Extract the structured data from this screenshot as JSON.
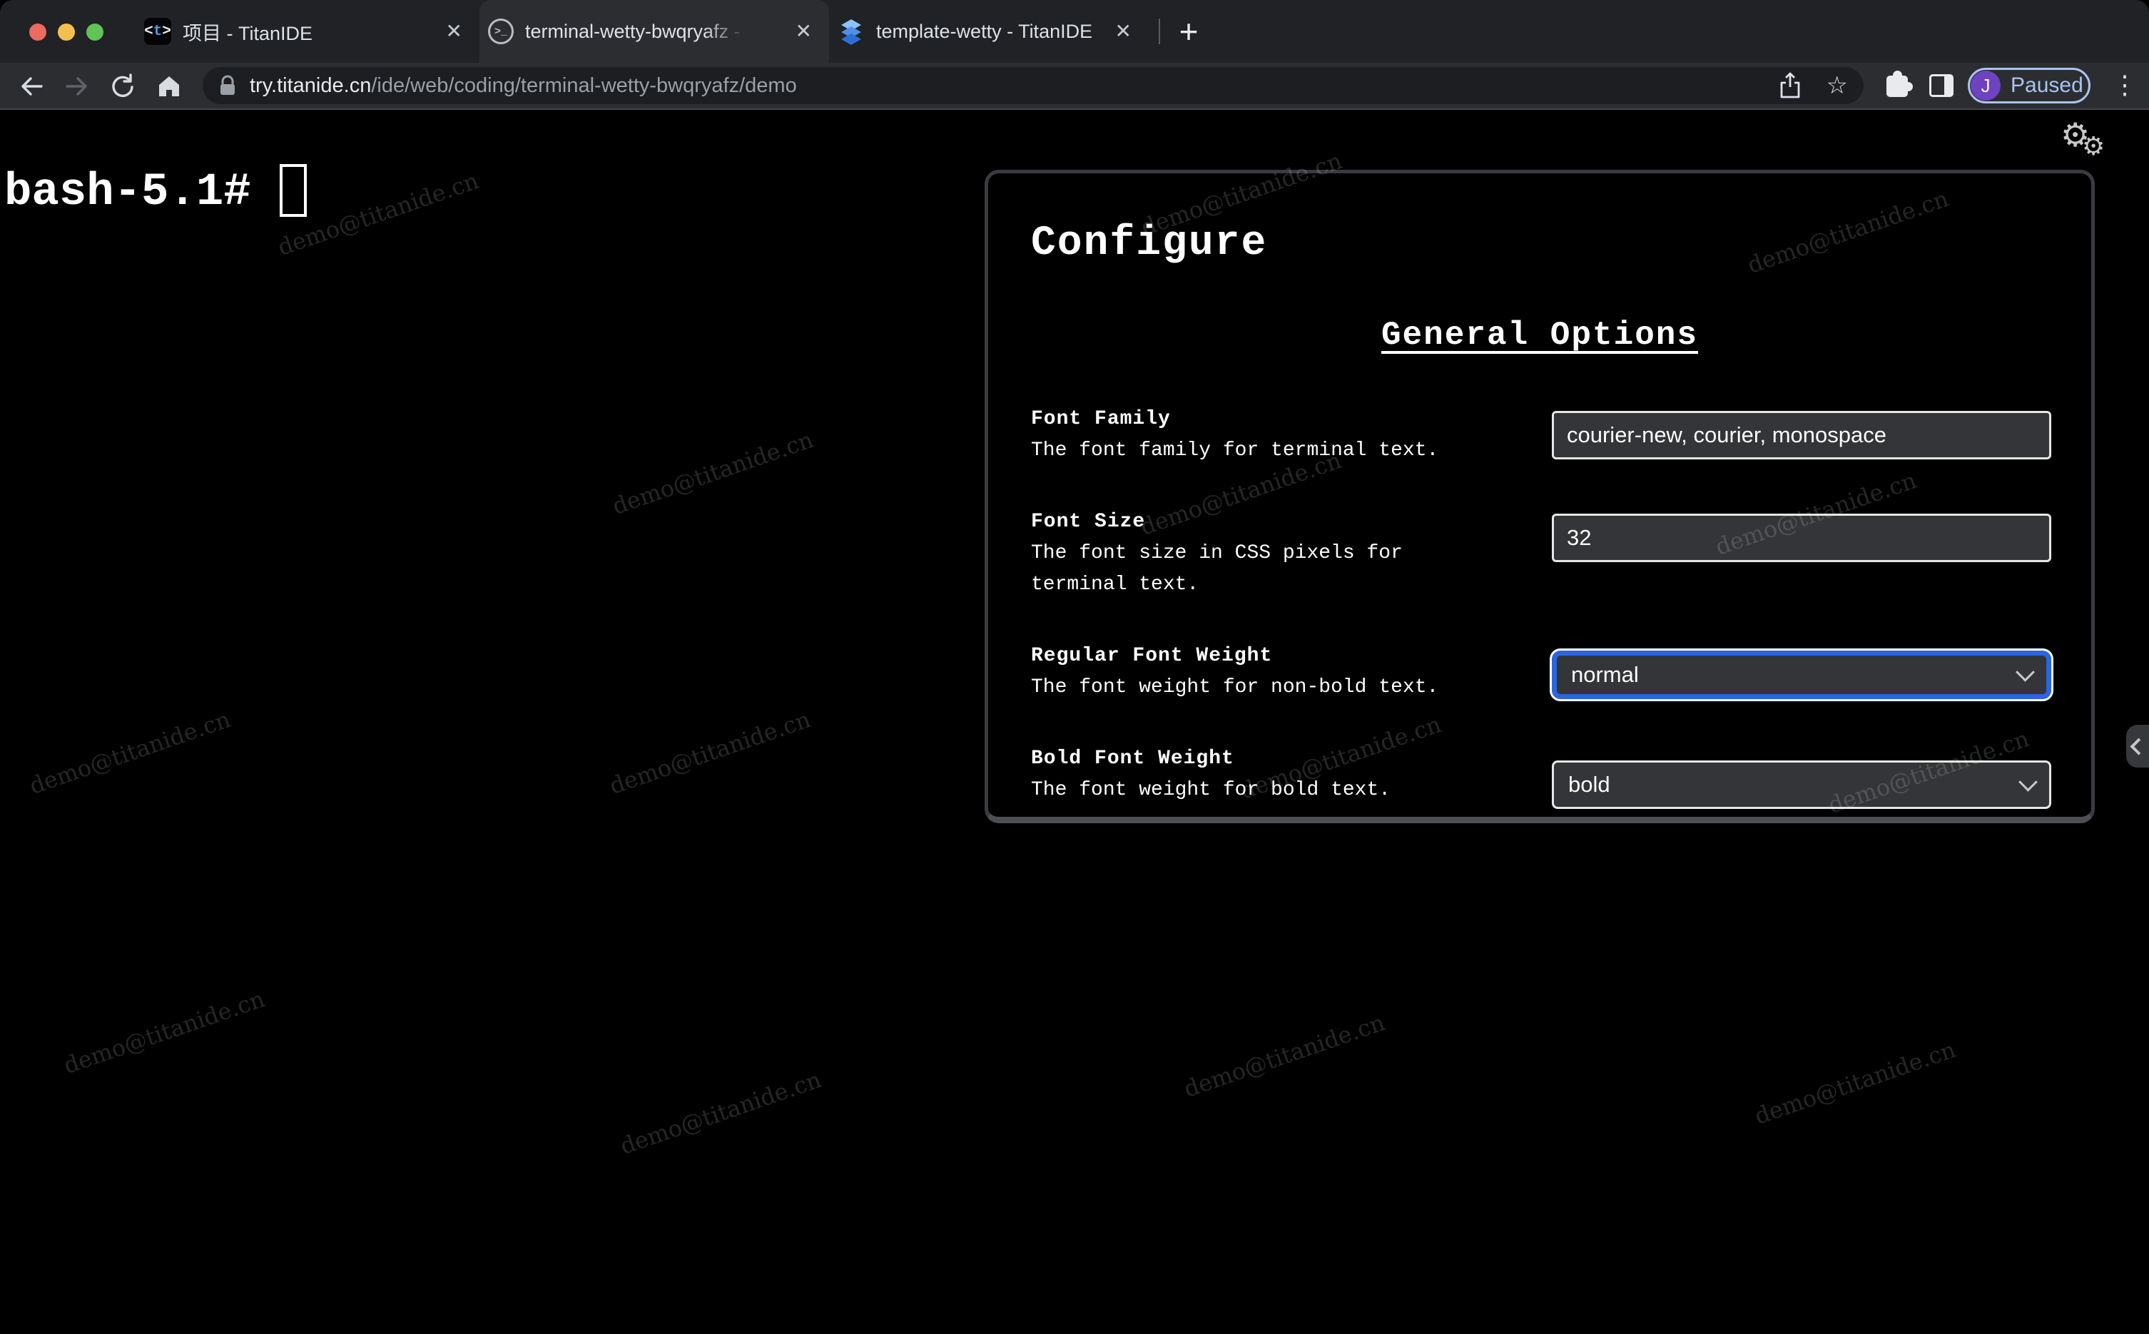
{
  "browser": {
    "tabs": [
      {
        "title": "项目 - TitanIDE",
        "favicon_parts": [
          "<",
          "t",
          ">"
        ]
      },
      {
        "title": "terminal-wetty-bwqryafz - Tita",
        "favicon_glyph": ">_",
        "active": true
      },
      {
        "title": "template-wetty - TitanIDE"
      }
    ],
    "tab_close_glyph": "✕",
    "new_tab_glyph": "+",
    "icons": {
      "back": "←",
      "forward": "→",
      "reload": "⟳",
      "star": "☆",
      "dots": "⋮",
      "gear_big": "⚙",
      "gear_small": "⚙"
    },
    "url_host": "try.titanide.cn",
    "url_path": "/ide/web/coding/terminal-wetty-bwqryafz/demo",
    "profile": {
      "initial": "J",
      "status": "Paused"
    }
  },
  "terminal": {
    "prompt": "bash-5.1#"
  },
  "panel": {
    "title": "Configure",
    "section": "General Options",
    "fields": [
      {
        "label": "Font Family",
        "description": "The font family for terminal text.",
        "control": "input",
        "value": "courier-new, courier, monospace"
      },
      {
        "label": "Font Size",
        "description": "The font size in CSS pixels for terminal text.",
        "control": "input",
        "value": "32"
      },
      {
        "label": "Regular Font Weight",
        "description": "The font weight for non-bold text.",
        "control": "select",
        "value": "normal",
        "focused": true
      },
      {
        "label": "Bold Font Weight",
        "description": "The font weight for bold text.",
        "control": "select",
        "value": "bold"
      }
    ]
  },
  "watermark": {
    "text": "demo@titanide.cn"
  },
  "colors": {
    "frame": "#202226",
    "toolbar": "#2C2D31",
    "omnibox": "#1D1E22",
    "focus_ring": "#2B65DF",
    "avatar": "#6E42C1",
    "paused_text": "#A8C4F0",
    "traffic": [
      "#ED6A5E",
      "#F5BF4F",
      "#61C454"
    ]
  }
}
